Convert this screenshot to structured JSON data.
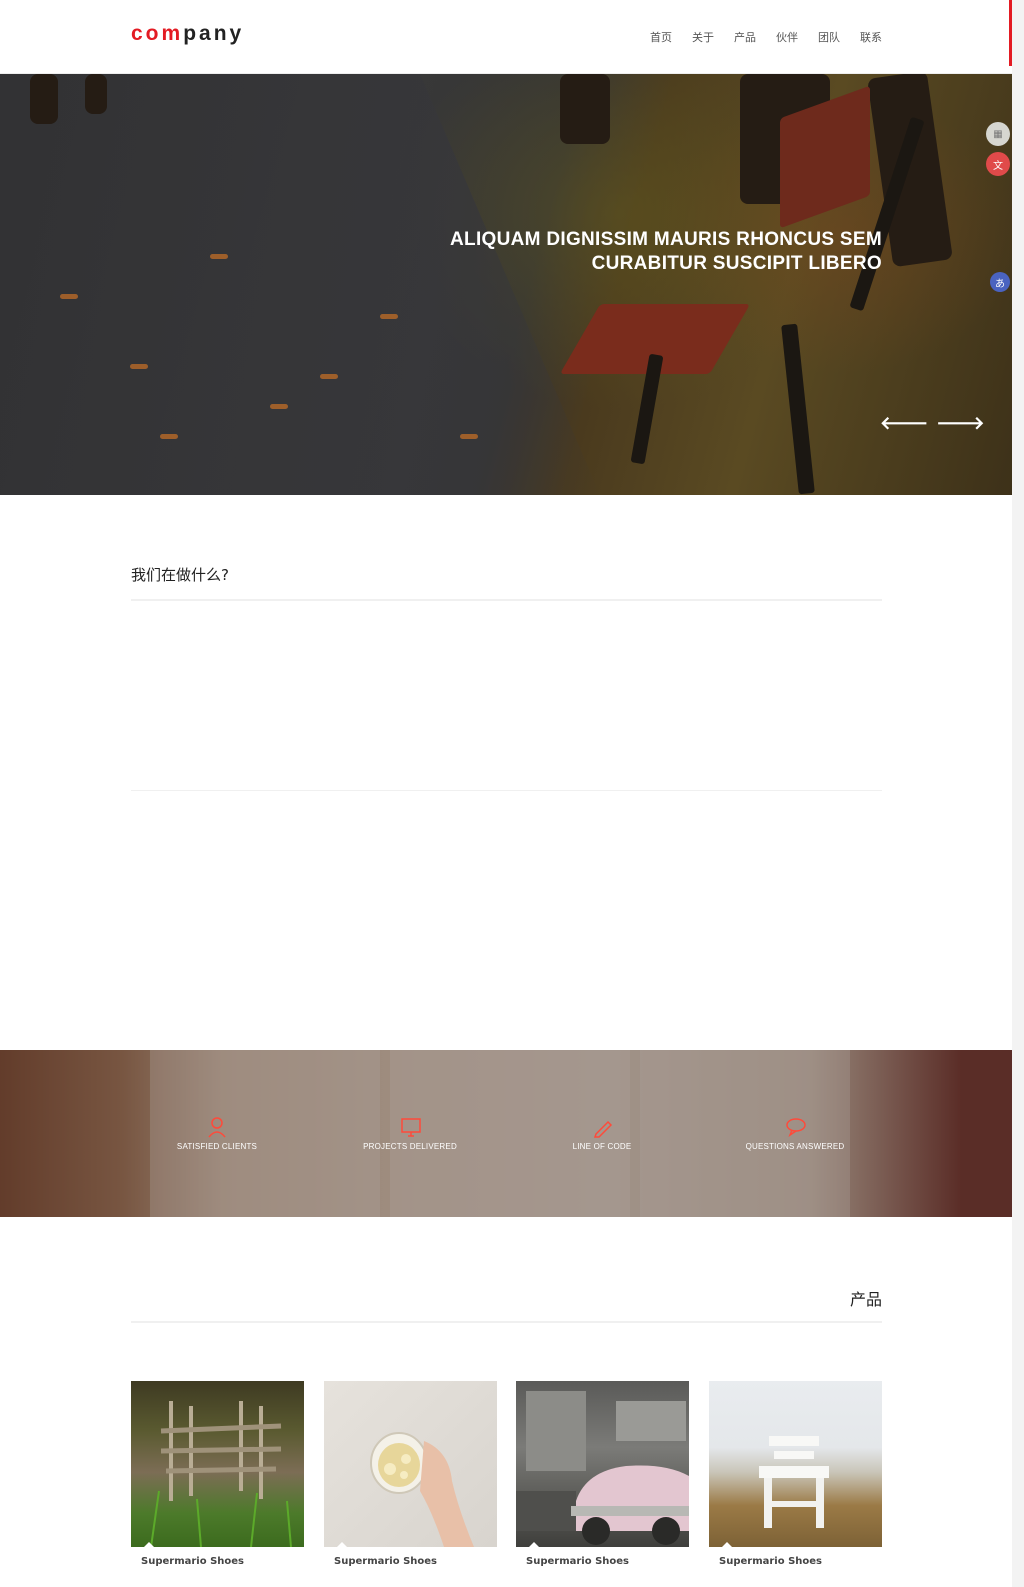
{
  "header": {
    "logo_part1": "com",
    "logo_part2": "pany",
    "nav": [
      "首页",
      "关于",
      "产品",
      "伙伴",
      "团队",
      "联系"
    ]
  },
  "hero": {
    "title_line1": "ALIQUAM DIGNISSIM MAURIS RHONCUS SEM",
    "title_line2": "CURABITUR SUSCIPIT LIBERO",
    "prev_arrow": "🡐",
    "next_arrow": "🡒"
  },
  "side_widgets": [
    "grid-icon",
    "translate-icon",
    "language-icon"
  ],
  "what_we_do": {
    "title": "我们在做什么?"
  },
  "stats": [
    {
      "icon": "user-icon",
      "label": "SATISFIED CLIENTS"
    },
    {
      "icon": "monitor-icon",
      "label": "PROJECTS DELIVERED"
    },
    {
      "icon": "pencil-icon",
      "label": "LINE OF CODE"
    },
    {
      "icon": "chat-icon",
      "label": "QUESTIONS ANSWERED"
    }
  ],
  "products": {
    "title": "产品",
    "items": [
      {
        "name": "Supermario Shoes"
      },
      {
        "name": "Supermario Shoes"
      },
      {
        "name": "Supermario Shoes"
      },
      {
        "name": "Supermario Shoes"
      }
    ]
  },
  "colors": {
    "brand_red": "#e31b23",
    "stat_icon": "#ff4a3a"
  }
}
